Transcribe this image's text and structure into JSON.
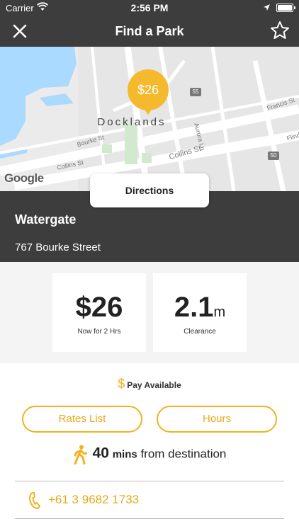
{
  "status_bar": {
    "carrier": "Carrier",
    "time": "2:56 PM"
  },
  "nav": {
    "title": "Find a Park",
    "close_icon": "close-icon",
    "favorite_icon": "star-outline-icon"
  },
  "map": {
    "pin_price": "$26",
    "area_label": "Docklands",
    "streets": [
      "Bourke St",
      "Collins St",
      "Collins St",
      "Francis St",
      "Aurora Ln",
      "Flinders"
    ],
    "route_shields": [
      "55",
      "50"
    ],
    "attribution": "Google"
  },
  "directions_label": "Directions",
  "location": {
    "name": "Watergate",
    "address": "767 Bourke Street"
  },
  "price_card": {
    "value": "$26",
    "caption": "Now for 2 Hrs"
  },
  "clearance_card": {
    "value": "2.1",
    "unit": "m",
    "caption": "Clearance"
  },
  "payment": {
    "icon": "dollar-icon",
    "label": "Pay Available"
  },
  "actions": {
    "rates": "Rates List",
    "hours": "Hours"
  },
  "walk": {
    "icon": "walking-person-icon",
    "minutes": "40",
    "unit": "mins",
    "suffix": "from destination"
  },
  "contact": {
    "icon": "phone-icon",
    "phone": "+61 3 9682 1733"
  },
  "colors": {
    "accent": "#f2b21f",
    "header": "#3d3d3d",
    "map_water": "#aadaff"
  }
}
